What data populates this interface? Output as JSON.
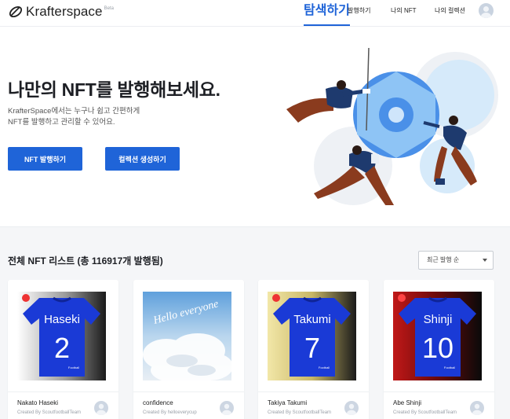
{
  "brand": {
    "name": "Krafterspace",
    "badge": "Beta"
  },
  "nav": {
    "items": [
      {
        "label": "탐색하기",
        "active": true
      },
      {
        "label": "발행하기",
        "active": false
      },
      {
        "label": "나의 NFT",
        "active": false
      },
      {
        "label": "나의 컬렉션",
        "active": false
      }
    ]
  },
  "hero": {
    "title": "나만의 NFT를 발행해보세요.",
    "desc_line1": "KrafterSpace에서는 누구나 쉽고 간편하게",
    "desc_line2": "NFT를 발행하고 관리할 수 있어요.",
    "mint_button": "NFT 발행하기",
    "collection_button": "컬렉션 생성하기"
  },
  "list": {
    "title": "전체 NFT 리스트 (총 116917개 발행됨)",
    "sort": {
      "selected": "최근 발행 순"
    }
  },
  "cards": [
    {
      "name": "Nakato Haseki",
      "creator": "Created By ScoutfootballTeam",
      "jersey_name": "Haseki",
      "jersey_number": "2",
      "jersey_logo": "Football"
    },
    {
      "name": "confidence",
      "creator": "Created By helloeverycup",
      "art_text": "Hello everyone"
    },
    {
      "name": "Takiya Takumi",
      "creator": "Created By ScoutfootballTeam",
      "jersey_name": "Takumi",
      "jersey_number": "7",
      "jersey_logo": "Football"
    },
    {
      "name": "Abe Shinji",
      "creator": "Created By ScoutfootballTeam",
      "jersey_name": "Shinji",
      "jersey_number": "10",
      "jersey_logo": "Football"
    }
  ],
  "colors": {
    "accent": "#1f64d8",
    "jersey": "#1a3ad6",
    "section_bg": "#f5f6f8"
  }
}
